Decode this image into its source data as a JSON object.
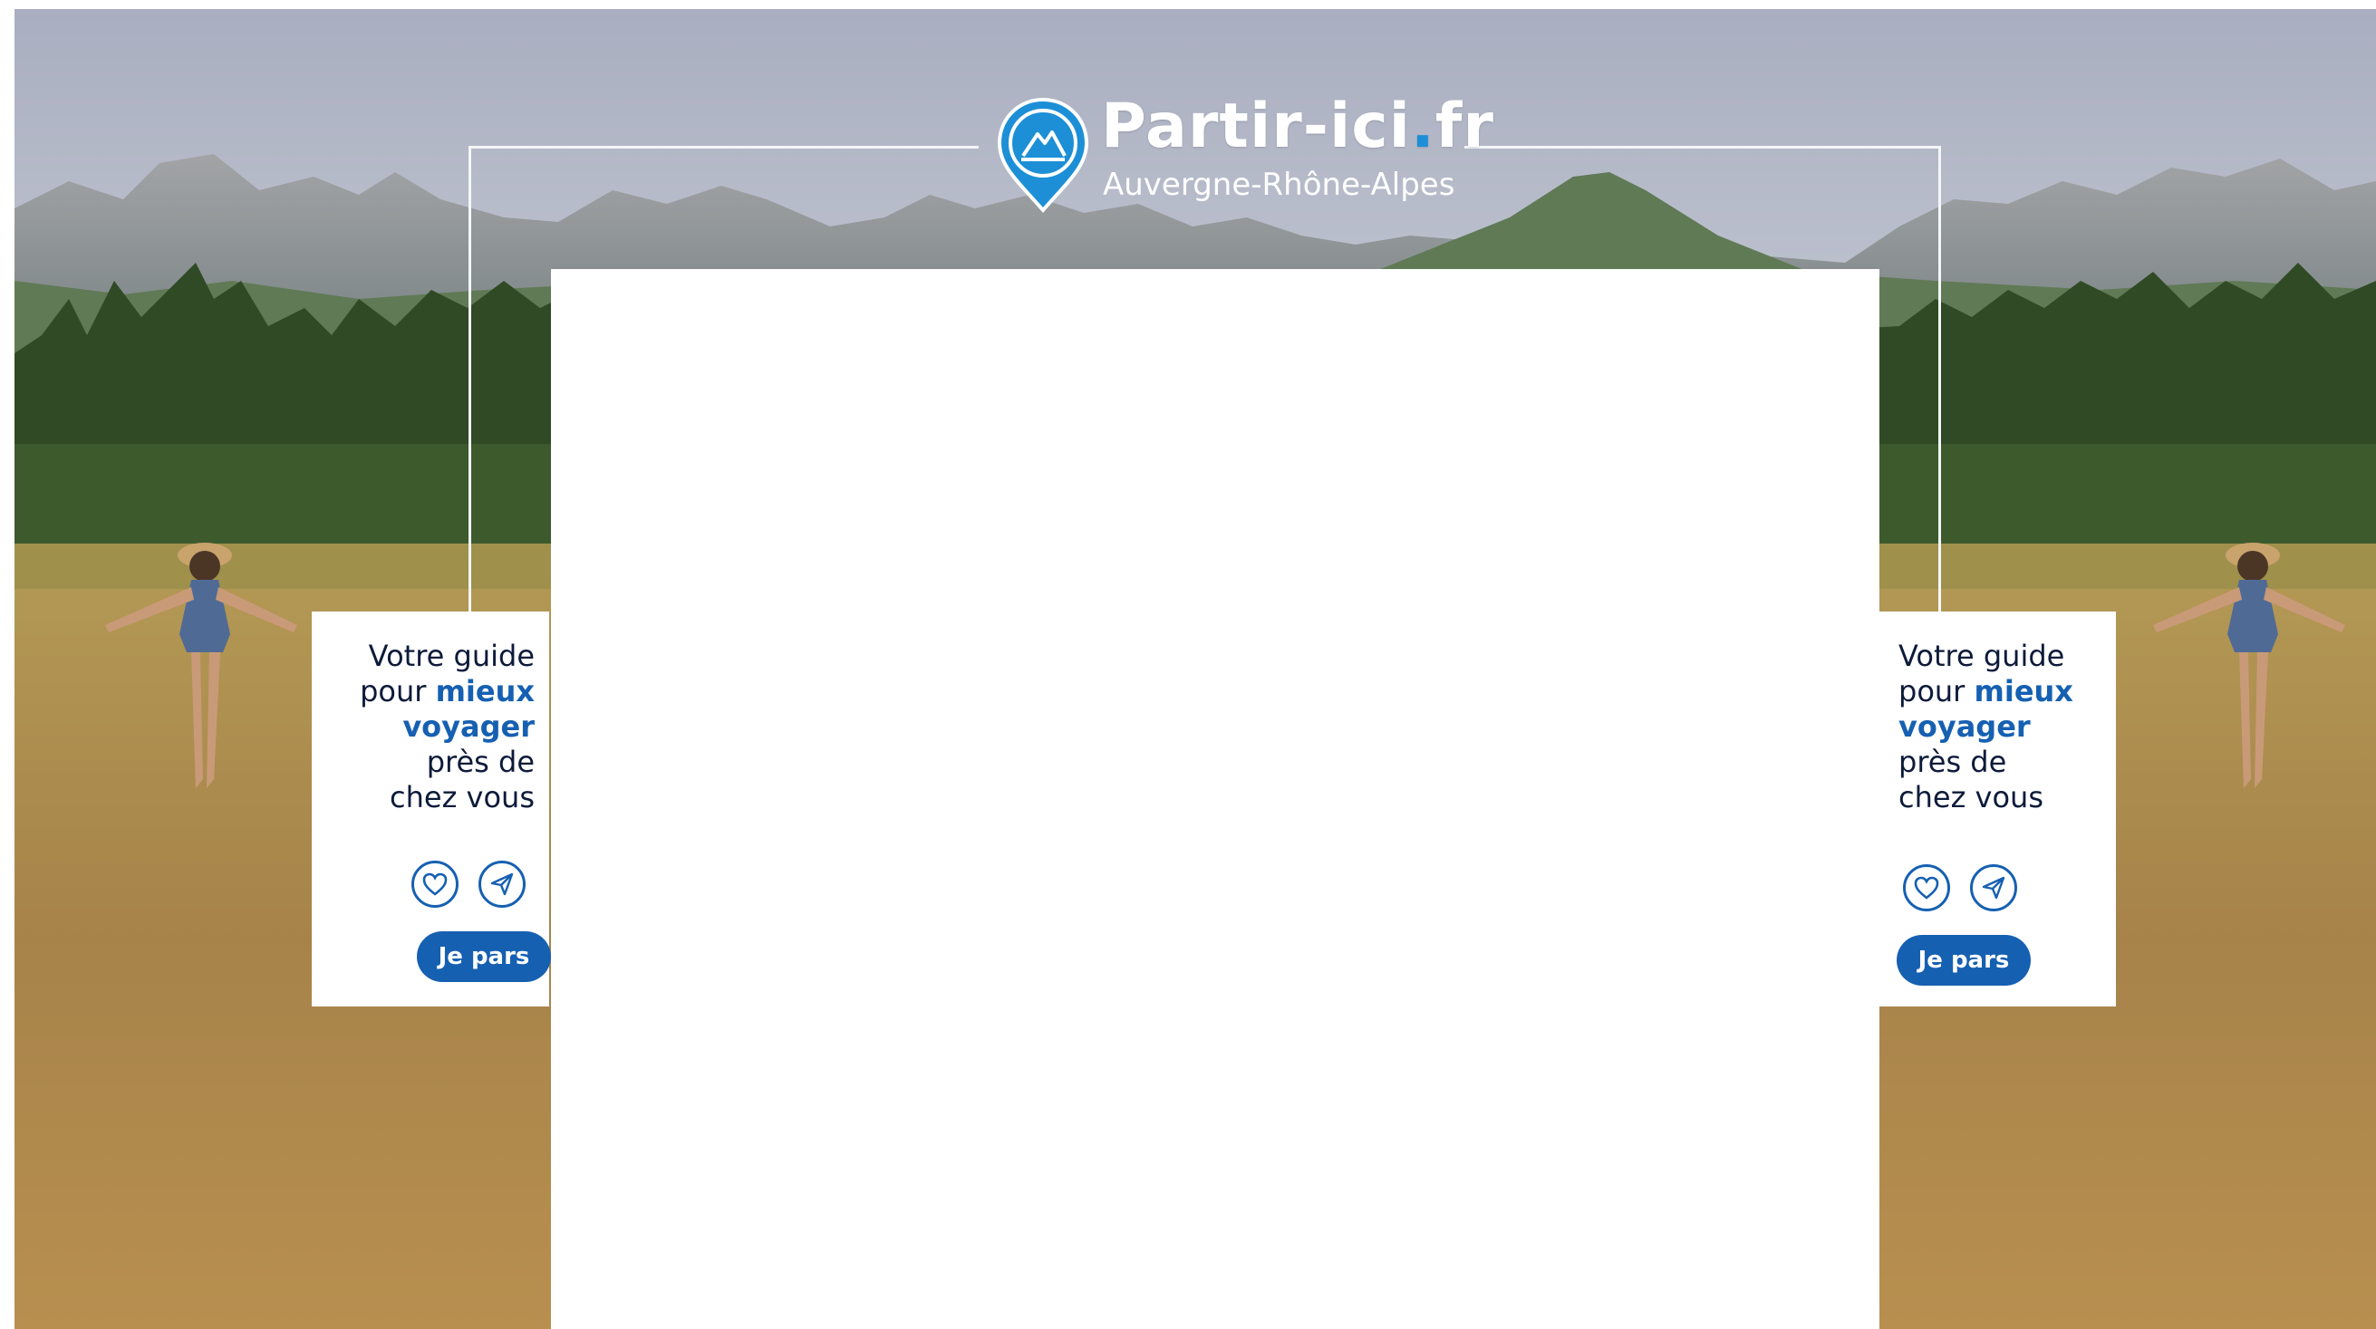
{
  "brand": {
    "name_main": "Partir-ici",
    "name_dot": ".",
    "name_tld": "fr",
    "region": "Auvergne-Rhône-Alpes"
  },
  "promo": {
    "tagline": {
      "line1": "Votre guide",
      "line2_pre": "pour ",
      "line2_highlight": "mieux",
      "line3_highlight": "voyager",
      "line4": "près de",
      "line5": "chez vous"
    },
    "cta_label": "Je pars",
    "icons": [
      "heart-icon",
      "send-icon"
    ]
  },
  "colors": {
    "brand_blue": "#1660b2",
    "logo_blue": "#1d8fd6",
    "text_dark": "#0d1b3a"
  }
}
